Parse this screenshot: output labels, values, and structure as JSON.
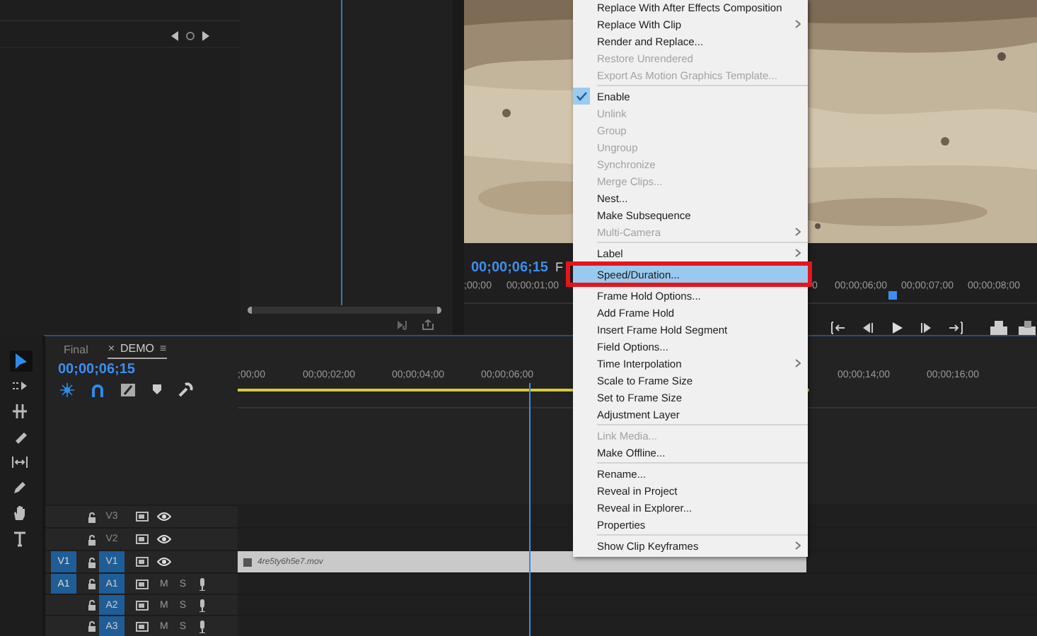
{
  "program_monitor": {
    "timecode": "00;00;06;15",
    "fit_label": "F",
    "ruler": [
      ";00;00",
      "00;00;01;00",
      "0",
      "00;00;06;00",
      "00;00;07;00",
      "00;00;08;00"
    ]
  },
  "tools": [
    {
      "kind": "selection",
      "selected": true
    },
    {
      "kind": "track-select",
      "selected": false
    },
    {
      "kind": "ripple",
      "selected": false
    },
    {
      "kind": "razor",
      "selected": false
    },
    {
      "kind": "slip",
      "selected": false
    },
    {
      "kind": "pen",
      "selected": false
    },
    {
      "kind": "hand",
      "selected": false
    },
    {
      "kind": "type",
      "selected": false
    }
  ],
  "timeline": {
    "tabs": [
      {
        "label": "Final",
        "selected": false
      },
      {
        "label": "DEMO",
        "selected": true
      }
    ],
    "close_glyph": "×",
    "menu_glyph": "≡",
    "timecode": "00;00;06;15",
    "ruler": [
      ";00;00",
      "00;00;02;00",
      "00;00;04;00",
      "00;00;06;00",
      "00;00;14;00",
      "00;00;16;00"
    ],
    "tracks": [
      {
        "kind": "video",
        "name": "V3",
        "targeted": false
      },
      {
        "kind": "video",
        "name": "V2",
        "targeted": false
      },
      {
        "kind": "video",
        "name": "V1",
        "targeted": true,
        "source": "V1"
      },
      {
        "kind": "audio",
        "name": "A1",
        "targeted": true,
        "source": "A1",
        "mute_label": "M",
        "solo_label": "S"
      },
      {
        "kind": "audio",
        "name": "A2",
        "targeted": true,
        "mute_label": "M",
        "solo_label": "S"
      },
      {
        "kind": "audio",
        "name": "A3",
        "targeted": true,
        "mute_label": "M",
        "solo_label": "S"
      }
    ],
    "clip": {
      "name": "4re5ty6h5e7.mov"
    }
  },
  "context_menu": {
    "items": [
      {
        "kind": "item",
        "label": "Replace With After Effects Composition",
        "disabled": false,
        "submenu": false
      },
      {
        "kind": "item",
        "label": "Replace With Clip",
        "disabled": false,
        "submenu": true
      },
      {
        "kind": "item",
        "label": "Render and Replace...",
        "disabled": false,
        "submenu": false
      },
      {
        "kind": "item",
        "label": "Restore Unrendered",
        "disabled": true,
        "submenu": false
      },
      {
        "kind": "item",
        "label": "Export As Motion Graphics Template...",
        "disabled": true,
        "submenu": false
      },
      {
        "kind": "separator"
      },
      {
        "kind": "item",
        "label": "Enable",
        "disabled": false,
        "submenu": false,
        "checked": true
      },
      {
        "kind": "item",
        "label": "Unlink",
        "disabled": true,
        "submenu": false
      },
      {
        "kind": "item",
        "label": "Group",
        "disabled": true,
        "submenu": false
      },
      {
        "kind": "item",
        "label": "Ungroup",
        "disabled": true,
        "submenu": false
      },
      {
        "kind": "item",
        "label": "Synchronize",
        "disabled": true,
        "submenu": false
      },
      {
        "kind": "item",
        "label": "Merge Clips...",
        "disabled": true,
        "submenu": false
      },
      {
        "kind": "item",
        "label": "Nest...",
        "disabled": false,
        "submenu": false
      },
      {
        "kind": "item",
        "label": "Make Subsequence",
        "disabled": false,
        "submenu": false
      },
      {
        "kind": "item",
        "label": "Multi-Camera",
        "disabled": true,
        "submenu": true
      },
      {
        "kind": "separator"
      },
      {
        "kind": "item",
        "label": "Label",
        "disabled": false,
        "submenu": true
      },
      {
        "kind": "item",
        "label": "Speed/Duration...",
        "disabled": false,
        "submenu": false,
        "highlighted": true,
        "outlined": true
      },
      {
        "kind": "item",
        "label": "Frame Hold Options...",
        "disabled": false,
        "submenu": false
      },
      {
        "kind": "item",
        "label": "Add Frame Hold",
        "disabled": false,
        "submenu": false
      },
      {
        "kind": "item",
        "label": "Insert Frame Hold Segment",
        "disabled": false,
        "submenu": false
      },
      {
        "kind": "item",
        "label": "Field Options...",
        "disabled": false,
        "submenu": false
      },
      {
        "kind": "item",
        "label": "Time Interpolation",
        "disabled": false,
        "submenu": true
      },
      {
        "kind": "item",
        "label": "Scale to Frame Size",
        "disabled": false,
        "submenu": false
      },
      {
        "kind": "item",
        "label": "Set to Frame Size",
        "disabled": false,
        "submenu": false
      },
      {
        "kind": "item",
        "label": "Adjustment Layer",
        "disabled": false,
        "submenu": false
      },
      {
        "kind": "separator"
      },
      {
        "kind": "item",
        "label": "Link Media...",
        "disabled": true,
        "submenu": false
      },
      {
        "kind": "item",
        "label": "Make Offline...",
        "disabled": false,
        "submenu": false
      },
      {
        "kind": "separator"
      },
      {
        "kind": "item",
        "label": "Rename...",
        "disabled": false,
        "submenu": false
      },
      {
        "kind": "item",
        "label": "Reveal in Project",
        "disabled": false,
        "submenu": false
      },
      {
        "kind": "item",
        "label": "Reveal in Explorer...",
        "disabled": false,
        "submenu": false
      },
      {
        "kind": "item",
        "label": "Properties",
        "disabled": false,
        "submenu": false
      },
      {
        "kind": "separator"
      },
      {
        "kind": "item",
        "label": "Show Clip Keyframes",
        "disabled": false,
        "submenu": true
      }
    ]
  }
}
